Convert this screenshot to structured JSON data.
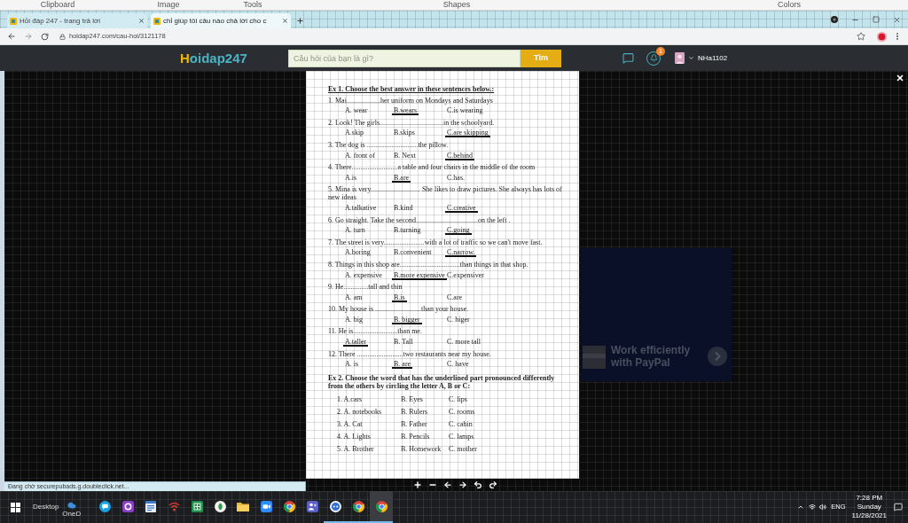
{
  "paint_ribbon": {
    "groups": [
      "Clipboard",
      "Image",
      "Tools",
      "Shapes",
      "Colors"
    ]
  },
  "browser": {
    "tabs": [
      {
        "title": "Hỏi đáp 247 - trang trả lời",
        "selected": false
      },
      {
        "title": "chỉ giúp tôi câu nào chả lời cho c",
        "selected": true
      }
    ],
    "url": "hoidap247.com/cau-hoi/3121178",
    "status": "Đang chờ securepubads.g.doubleclick.net..."
  },
  "site_header": {
    "logo": "Hoidap247",
    "search": {
      "placeholder": "Câu hỏi của bạn là gì?"
    },
    "search_button": "Tìm",
    "notification_badge": "1",
    "username": "NHa1102"
  },
  "document": {
    "exercises": [
      {
        "kind": "multiple_choice",
        "title": "Ex 1. Choose  the best answer in these sentences below.:",
        "underlined": true,
        "questions": [
          {
            "text": "1. Mai...................her uniform on Mondays and Saturdays",
            "options": [
              {
                "text": "A. wear",
                "selected": false
              },
              {
                "text": "B.wears",
                "selected": true
              },
              {
                "text": "C.is wearing",
                "selected": false
              }
            ]
          },
          {
            "text": "2. Look! The girls....................................in the schoolyard.",
            "options": [
              {
                "text": "A.skip",
                "selected": false
              },
              {
                "text": "B.skips",
                "selected": false
              },
              {
                "text": "C.are skipping",
                "selected": true
              }
            ]
          },
          {
            "text": "3. The dog is .............................the pillow.",
            "options": [
              {
                "text": "A. front of",
                "selected": false
              },
              {
                "text": "B. Next",
                "selected": false
              },
              {
                "text": "C.behind",
                "selected": true
              }
            ]
          },
          {
            "text": "4. There..........................a table and four chairs in the middle of the room",
            "options": [
              {
                "text": "A.is",
                "selected": false
              },
              {
                "text": "B.are",
                "selected": true
              },
              {
                "text": "C.has.",
                "selected": false
              }
            ]
          },
          {
            "text": "5. Mina is very............................ She likes to draw pictures. She always has lots of new ideas",
            "options": [
              {
                "text": "A.talkative",
                "selected": false
              },
              {
                "text": "B.kind",
                "selected": false
              },
              {
                "text": "C.creative",
                "selected": true
              }
            ]
          },
          {
            "text": "6. Go straight. Take the second...................................on the left .",
            "options": [
              {
                "text": "A. turn",
                "selected": false
              },
              {
                "text": "B.turning",
                "selected": false
              },
              {
                "text": "C.going",
                "selected": true
              }
            ]
          },
          {
            "text": "7. The street is very.......................with a lot of traffic so we can't move fast.",
            "options": [
              {
                "text": "A.boring",
                "selected": false
              },
              {
                "text": "B.convenient",
                "selected": false
              },
              {
                "text": "C.narrow.",
                "selected": true
              }
            ]
          },
          {
            "text": "8. Things in this shop are..................................than things in that shop.",
            "options": [
              {
                "text": "A. expensive",
                "selected": false
              },
              {
                "text": "B.more expensive",
                "selected": true
              },
              {
                "text": "C.expensiver",
                "selected": false
              }
            ]
          },
          {
            "text": "9. He..............tall and thin",
            "options": [
              {
                "text": "A. am",
                "selected": false
              },
              {
                "text": "B.is",
                "selected": true
              },
              {
                "text": "C.are",
                "selected": false
              }
            ]
          },
          {
            "text": "10. My house is ..........................than your house.",
            "options": [
              {
                "text": "A. big",
                "selected": false
              },
              {
                "text": "B. bigger",
                "selected": true
              },
              {
                "text": "C. higer",
                "selected": false
              }
            ]
          },
          {
            "text": "11. He is.........................than me.",
            "options": [
              {
                "text": "A.taller",
                "selected": true
              },
              {
                "text": "B. Tall",
                "selected": false
              },
              {
                "text": "C. more tall",
                "selected": false
              }
            ]
          },
          {
            "text": "12. There ..........................two restaurants near my house.",
            "options": [
              {
                "text": "A. is",
                "selected": false
              },
              {
                "text": "B. are",
                "selected": true
              },
              {
                "text": "C. have",
                "selected": false
              }
            ]
          }
        ]
      },
      {
        "kind": "pronunciation",
        "title": "Ex 2. Choose the word that has the underlined part pronounced differently from the others by circling the letter A, B or C:",
        "underlined": false,
        "items": [
          {
            "options": [
              "1. A.cars",
              "B. Eyes",
              "C. lips"
            ]
          },
          {
            "options": [
              "2. A. notebooks",
              "B. Rulers",
              "C. rooms"
            ]
          },
          {
            "options": [
              "3. A. Cat",
              "B. Father",
              "C. cabin"
            ]
          },
          {
            "options": [
              "4. A. Lights",
              "B. Pencils",
              "C. lamps"
            ]
          },
          {
            "options": [
              "5. A. Brother",
              "B. Homework",
              "C. mother"
            ]
          }
        ]
      }
    ]
  },
  "background_ad": {
    "headline": "Work efficiently",
    "subline": "with PayPal"
  },
  "taskbar": {
    "desktop_label": "Desktop",
    "onedrive_label": "OneD",
    "apps": [
      {
        "kind": "skype",
        "selected": false,
        "running": false
      },
      {
        "kind": "ring",
        "selected": false,
        "running": false
      },
      {
        "kind": "document",
        "selected": false,
        "running": false
      },
      {
        "kind": "signal",
        "selected": false,
        "running": false
      },
      {
        "kind": "sheet",
        "selected": false,
        "running": false
      },
      {
        "kind": "round",
        "selected": false,
        "running": false
      },
      {
        "kind": "folder",
        "selected": false,
        "running": false
      },
      {
        "kind": "camera",
        "selected": false,
        "running": false
      },
      {
        "kind": "browser",
        "selected": false,
        "running": false
      },
      {
        "kind": "people",
        "selected": false,
        "running": false
      },
      {
        "kind": "web",
        "selected": false,
        "running": true
      },
      {
        "kind": "browser",
        "selected": false,
        "running": true
      },
      {
        "kind": "browser",
        "selected": true,
        "running": true
      }
    ],
    "tray": {
      "language": "ENG",
      "time": "7:28 PM",
      "day": "Sunday",
      "date": "11/28/2021"
    }
  }
}
